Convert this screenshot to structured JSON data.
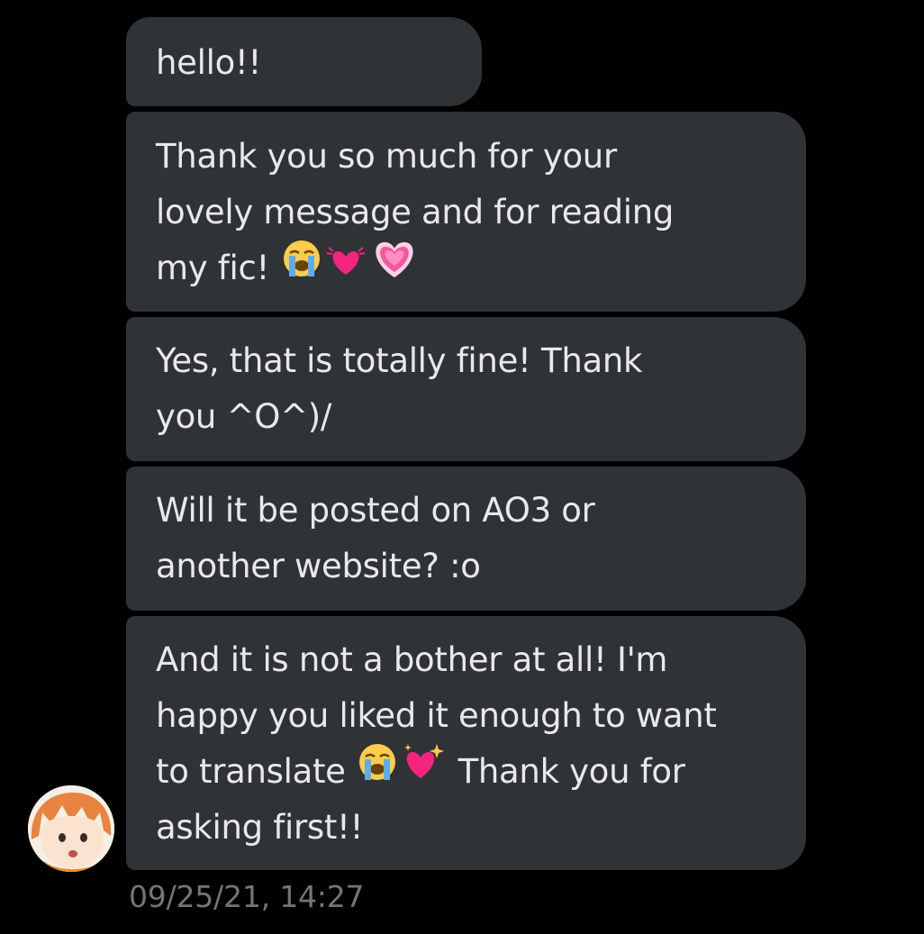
{
  "conversation": {
    "messages": [
      {
        "lines": [
          "hello!!"
        ]
      },
      {
        "lines": [
          "Thank you so much for your",
          "lovely message and for reading",
          "my fic!"
        ]
      },
      {
        "lines": [
          "Yes, that is totally fine! Thank",
          "you ^O^)/"
        ]
      },
      {
        "lines": [
          "Will it be posted on AO3 or",
          "another website? :o"
        ]
      },
      {
        "lines": [
          "And it is not a bother at all! I'm",
          "happy you liked it enough to want",
          "to translate",
          "Thank you for",
          "asking first!!"
        ]
      }
    ],
    "timestamp": "09/25/21, 14:27",
    "emoji_icons": [
      "loudly-crying-face-icon",
      "beating-heart-icon",
      "growing-heart-icon",
      "sparkling-heart-icon"
    ],
    "colors": {
      "background": "#000000",
      "bubble": "#2f3336",
      "text": "#e7e9ea",
      "timestamp": "#71767b"
    }
  }
}
